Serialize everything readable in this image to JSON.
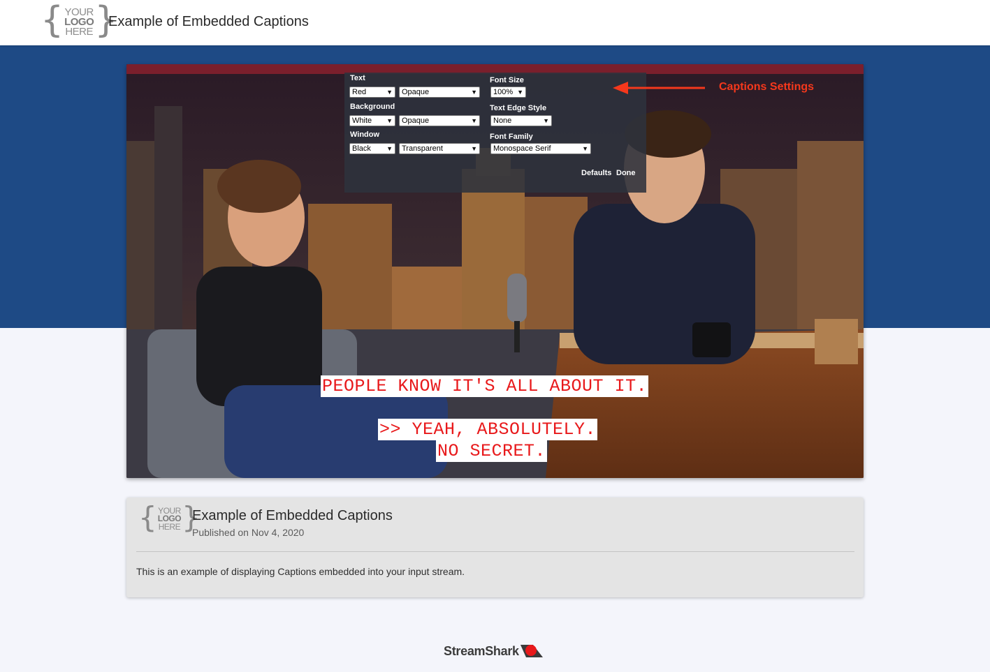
{
  "header": {
    "logo": {
      "line1": "YOUR",
      "line2": "LOGO",
      "line3": "HERE"
    },
    "title": "Example of Embedded Captions"
  },
  "player": {
    "settings": {
      "text_label": "Text",
      "text_color": "Red",
      "text_opacity": "Opaque",
      "background_label": "Background",
      "background_color": "White",
      "background_opacity": "Opaque",
      "window_label": "Window",
      "window_color": "Black",
      "window_opacity": "Transparent",
      "font_size_label": "Font Size",
      "font_size": "100%",
      "edge_style_label": "Text Edge Style",
      "edge_style": "None",
      "font_family_label": "Font Family",
      "font_family": "Monospace Serif",
      "defaults_label": "Defaults",
      "done_label": "Done"
    },
    "annotation": "Captions Settings",
    "captions": {
      "line1": "PEOPLE KNOW IT'S ALL ABOUT IT.",
      "line2": ">> YEAH, ABSOLUTELY.",
      "line3": "NO SECRET."
    }
  },
  "card": {
    "logo": {
      "line1": "YOUR",
      "line2": "LOGO",
      "line3": "HERE"
    },
    "title": "Example of Embedded Captions",
    "published": "Published on Nov 4, 2020",
    "description": "This is an example of displaying Captions embedded into your input stream."
  },
  "footer": {
    "brand": "StreamShark"
  },
  "colors": {
    "band": "#1e4a85",
    "page_bg": "#f4f5fb",
    "annotation": "#f5381c",
    "caption_text": "#e8191b",
    "caption_bg": "#ffffff"
  }
}
